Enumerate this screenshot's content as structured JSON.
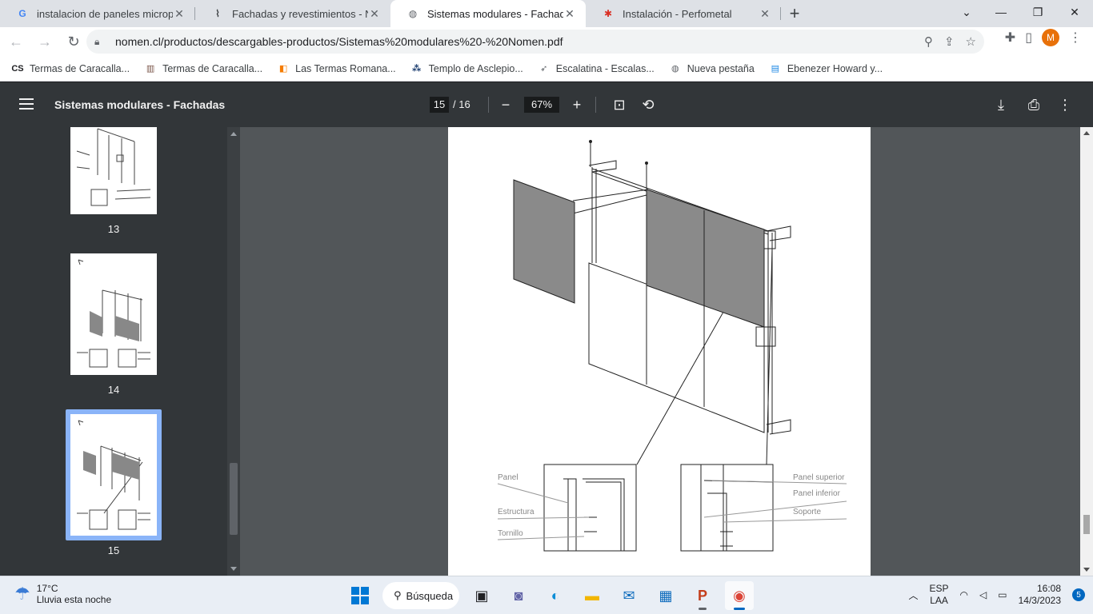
{
  "browser": {
    "tabs": [
      {
        "title": "instalacion de paneles microperfo",
        "icon": "google-icon",
        "active": false
      },
      {
        "title": "Fachadas y revestimientos - Nom",
        "icon": "nomen-icon",
        "active": false
      },
      {
        "title": "Sistemas modulares - Fachadas",
        "icon": "globe-icon",
        "active": true
      },
      {
        "title": "Instalación - Perfometal",
        "icon": "perfometal-icon",
        "active": false
      }
    ],
    "url": "nomen.cl/productos/descargables-productos/Sistemas%20modulares%20-%20Nomen.pdf",
    "avatar_letter": "M",
    "bookmarks": [
      {
        "label": "Termas de Caracalla...",
        "icon": "cs-icon"
      },
      {
        "label": "Termas de Caracalla...",
        "icon": "building-icon"
      },
      {
        "label": "Las Termas Romana...",
        "icon": "orange-icon"
      },
      {
        "label": "Templo de Asclepio...",
        "icon": "dots-icon"
      },
      {
        "label": "Escalatina - Escalas...",
        "icon": "bird-icon"
      },
      {
        "label": "Nueva pestaña",
        "icon": "globe-icon"
      },
      {
        "label": "Ebenezer Howard y...",
        "icon": "book-icon"
      }
    ]
  },
  "pdf": {
    "title": "Sistemas modulares - Fachadas",
    "current_page": "15",
    "total_pages": "/ 16",
    "zoom": "67%",
    "thumbnails": [
      "13",
      "14",
      "15"
    ],
    "drawing_labels_left": [
      "Panel",
      "Estructura",
      "Tornillo"
    ],
    "drawing_labels_right": [
      "Panel superior",
      "Panel inferior",
      "Soporte"
    ]
  },
  "taskbar": {
    "temperature": "17°C",
    "weather_text": "Lluvia esta noche",
    "search_label": "Búsqueda",
    "lang_top": "ESP",
    "lang_bottom": "LAA",
    "time": "16:08",
    "date": "14/3/2023",
    "notifications": "5"
  }
}
